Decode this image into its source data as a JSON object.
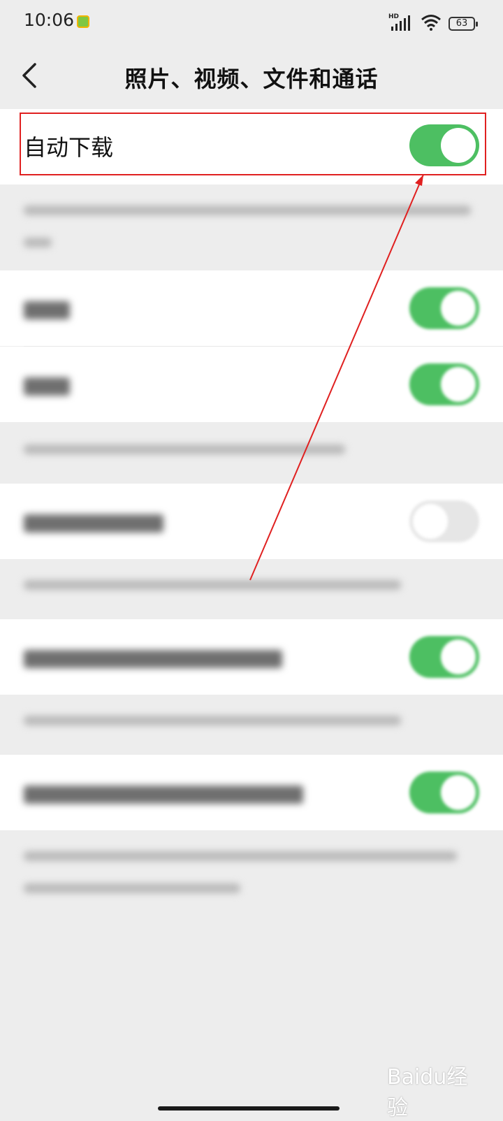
{
  "status_bar": {
    "time": "10:06",
    "hd_label": "HD",
    "battery": "63"
  },
  "header": {
    "title": "照片、视频、文件和通话"
  },
  "auto_download": {
    "label": "自动下载",
    "enabled": true
  },
  "colors": {
    "accent_green": "#4dbf62",
    "highlight_red": "#e02020",
    "background": "#ededed"
  },
  "icons": {
    "back": "chevron-left-icon",
    "signal": "signal-icon",
    "wifi": "wifi-icon",
    "battery": "battery-icon",
    "app_badge": "app-badge-icon"
  },
  "settings": [
    {
      "id": "photos",
      "enabled": true
    },
    {
      "id": "videos",
      "enabled": true
    },
    {
      "id": "option3",
      "enabled": false
    },
    {
      "id": "option4",
      "enabled": true
    },
    {
      "id": "option5",
      "enabled": true
    }
  ],
  "watermark": {
    "text": "Baidu经验"
  }
}
